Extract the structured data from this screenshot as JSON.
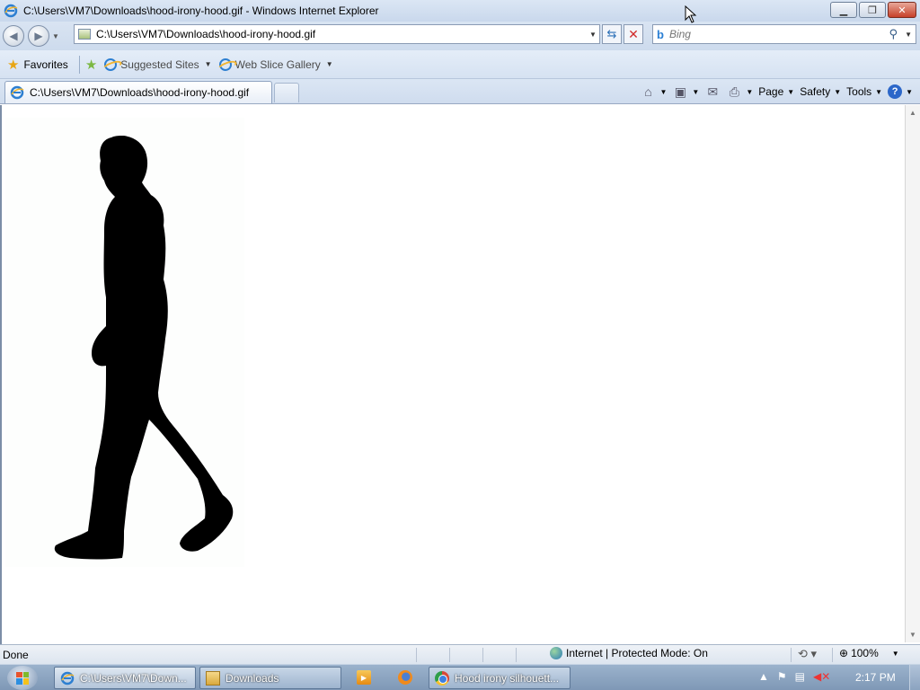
{
  "window": {
    "title": "C:\\Users\\VM7\\Downloads\\hood-irony-hood.gif - Windows Internet Explorer",
    "minimize_icon": "minimize-icon",
    "restore_icon": "restore-icon",
    "close_icon": "close-icon"
  },
  "addressbar": {
    "url": "C:\\Users\\VM7\\Downloads\\hood-irony-hood.gif"
  },
  "search": {
    "placeholder": "Bing"
  },
  "favorites_bar": {
    "favorites_label": "Favorites",
    "items": [
      {
        "label": "Suggested Sites"
      },
      {
        "label": "Web Slice Gallery"
      }
    ]
  },
  "tabs": [
    {
      "label": "C:\\Users\\VM7\\Downloads\\hood-irony-hood.gif",
      "active": true
    }
  ],
  "command_bar": {
    "page_label": "Page",
    "safety_label": "Safety",
    "tools_label": "Tools"
  },
  "content": {
    "image_alt": "hood-irony-hood.gif"
  },
  "statusbar": {
    "status": "Done",
    "zone": "Internet | Protected Mode: On",
    "zoom": "100%"
  },
  "taskbar": {
    "items": [
      {
        "label": "C:\\Users\\VM7\\Down...",
        "active": true
      },
      {
        "label": "Downloads",
        "active": false
      },
      {
        "label": "Hood irony silhouett...",
        "active": false
      }
    ],
    "clock": "2:17 PM"
  },
  "colors": {
    "chrome_blue": "#cddbed",
    "close_red": "#c7402a",
    "silhouette": "#000000"
  }
}
